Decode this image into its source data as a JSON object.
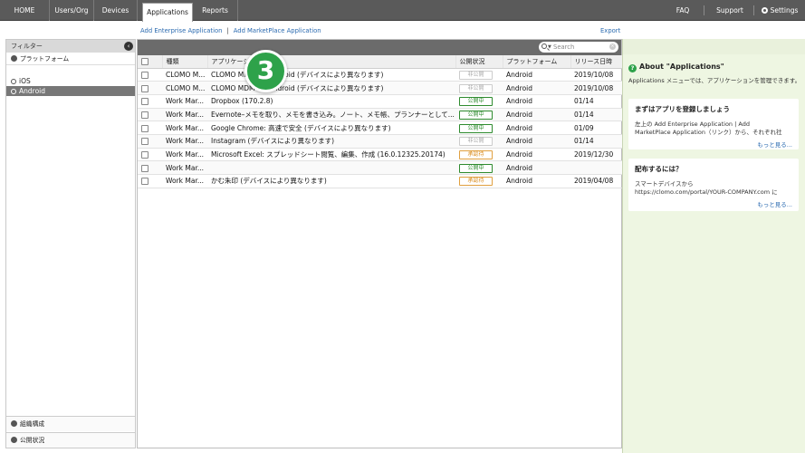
{
  "nav": {
    "tabs": [
      {
        "label": "HOME"
      },
      {
        "label": "Users/Org"
      },
      {
        "label": "Devices"
      },
      {
        "label": "Applications",
        "active": true
      },
      {
        "label": "Reports"
      }
    ],
    "right": {
      "faq": "FAQ",
      "support": "Support",
      "settings": "Settings"
    }
  },
  "actions": {
    "add_enterprise": "Add Enterprise Application",
    "separator": "|",
    "add_marketplace": "Add MarketPlace Application",
    "export": "Export"
  },
  "sidebar": {
    "header": "フィルター",
    "platform_label": "プラットフォーム",
    "platforms": [
      {
        "label": "iOS",
        "active": false
      },
      {
        "label": "Android",
        "active": true
      }
    ],
    "org_label": "組織構成",
    "status_label": "公開状況"
  },
  "search": {
    "placeholder": "Search"
  },
  "table": {
    "columns": [
      "種類",
      "アプリケーション",
      "公開状況",
      "プラットフォーム",
      "リリース日時"
    ],
    "rows": [
      {
        "type": "CLOMO M...",
        "name": "CLOMO MDM for Android (デバイスにより異なります)",
        "status": "非公開",
        "status_kind": "private",
        "platform": "Android",
        "date": "2019/10/08"
      },
      {
        "type": "CLOMO M...",
        "name": "CLOMO MDM for Android (デバイスにより異なります)",
        "status": "非公開",
        "status_kind": "private",
        "platform": "Android",
        "date": "2019/10/08"
      },
      {
        "type": "Work Mar...",
        "name": "Dropbox (170.2.8)",
        "status": "公開中",
        "status_kind": "public",
        "platform": "Android",
        "date": "01/14"
      },
      {
        "type": "Work Mar...",
        "name": "Evernote–メモを取り、メモを書き込み。ノート、メモ帳、プランナーとして...",
        "status": "公開中",
        "status_kind": "public",
        "platform": "Android",
        "date": "01/14"
      },
      {
        "type": "Work Mar...",
        "name": "Google Chrome: 高速で安全 (デバイスにより異なります)",
        "status": "公開中",
        "status_kind": "public",
        "platform": "Android",
        "date": "01/09"
      },
      {
        "type": "Work Mar...",
        "name": "Instagram (デバイスにより異なります)",
        "status": "非公開",
        "status_kind": "private",
        "platform": "Android",
        "date": "01/14"
      },
      {
        "type": "Work Mar...",
        "name": "Microsoft Excel: スプレッドシート閲覧、編集、作成 (16.0.12325.20174)",
        "status": "承認待",
        "status_kind": "pending",
        "platform": "Android",
        "date": "2019/12/30"
      },
      {
        "type": "Work Mar...",
        "name": "",
        "status": "公開中",
        "status_kind": "public",
        "platform": "Android",
        "date": ""
      },
      {
        "type": "Work Mar...",
        "name": "かむ朱印 (デバイスにより異なります)",
        "status": "承認待",
        "status_kind": "pending",
        "platform": "Android",
        "date": "2019/04/08"
      }
    ]
  },
  "callout": {
    "number": "3"
  },
  "help": {
    "title": "About \"Applications\"",
    "desc": "Applications メニューでは、アプリケーションを管理できます。",
    "card1": {
      "title": "まずはアプリを登録しましょう",
      "line1": "左上の Add Enterprise Application | Add",
      "line2": "MarketPlace Application（リンク）から、それぞれ社",
      "more": "もっと見る..."
    },
    "card2": {
      "title": "配布するには？",
      "line1": "スマートデバイスから",
      "line2": "https://clomo.com/portal/YOUR-COMPANY.com に",
      "more": "もっと見る..."
    }
  },
  "colors": {
    "accent_green": "#2ea24a",
    "link_blue": "#2a6ab0",
    "nav_bg": "#5a5a5a",
    "help_bg": "#eef6e2"
  }
}
